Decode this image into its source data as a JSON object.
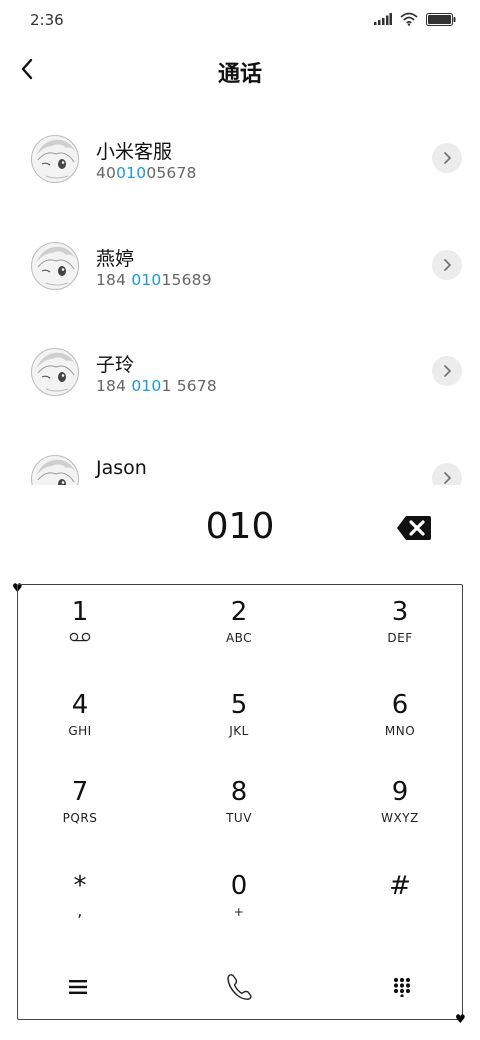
{
  "status_bar": {
    "time": "2:36"
  },
  "header": {
    "title": "通话"
  },
  "contacts": [
    {
      "name": "小米客服",
      "number_parts": [
        "40",
        "010",
        "05678"
      ]
    },
    {
      "name": "燕婷",
      "number_parts": [
        "184 ",
        "010",
        "15689"
      ]
    },
    {
      "name": "子玲",
      "number_parts": [
        "184 ",
        "010",
        "1 5678"
      ]
    },
    {
      "name": "Jason",
      "number_parts": [
        "",
        "",
        ""
      ]
    }
  ],
  "dialer": {
    "input": "010",
    "keys": [
      {
        "digit": "1",
        "letters": ""
      },
      {
        "digit": "2",
        "letters": "ABC"
      },
      {
        "digit": "3",
        "letters": "DEF"
      },
      {
        "digit": "4",
        "letters": "GHI"
      },
      {
        "digit": "5",
        "letters": "JKL"
      },
      {
        "digit": "6",
        "letters": "MNO"
      },
      {
        "digit": "7",
        "letters": "PQRS"
      },
      {
        "digit": "8",
        "letters": "TUV"
      },
      {
        "digit": "9",
        "letters": "WXYZ"
      },
      {
        "digit": "*",
        "letters": ","
      },
      {
        "digit": "0",
        "letters": "+"
      },
      {
        "digit": "#",
        "letters": ""
      }
    ]
  },
  "colors": {
    "highlight": "#1a9ad6",
    "text": "#111111",
    "secondary": "#666666",
    "detail_bg": "#ececec"
  },
  "icons": [
    "signal-icon",
    "wifi-icon",
    "battery-icon",
    "back-arrow-icon",
    "chevron-right-icon",
    "backspace-icon",
    "voicemail-icon",
    "menu-icon",
    "phone-icon",
    "dialpad-icon"
  ]
}
